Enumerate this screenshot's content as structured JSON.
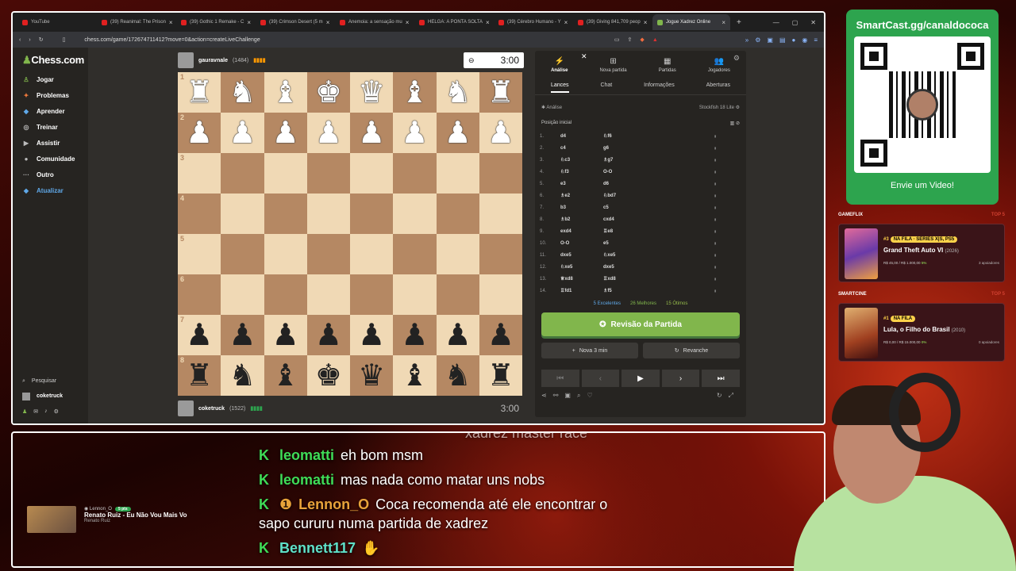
{
  "browser": {
    "tabs": [
      {
        "title": "YouTube"
      },
      {
        "title": "(39) Reanimal: The Prison"
      },
      {
        "title": "(39) Gothic 1 Remake - C"
      },
      {
        "title": "(39) Crimson Desert (5 m"
      },
      {
        "title": "Anemoia: a sensação mu"
      },
      {
        "title": "HELGA: A PONTA SOLTA"
      },
      {
        "title": "(39) Cérebro Humano - Y"
      },
      {
        "title": "(39) Giving 841,709 peop"
      },
      {
        "title": "Jogue Xadrez Online"
      }
    ],
    "url": "chess.com/game/172674711412?move=0&action=createLiveChallenge"
  },
  "chess": {
    "logo": "Chess.com",
    "nav": [
      {
        "icon": "♙",
        "label": "Jogar",
        "color": "#81b64c"
      },
      {
        "icon": "✦",
        "label": "Problemas",
        "color": "#f07a3c"
      },
      {
        "icon": "🎓",
        "label": "Aprender",
        "color": "#5fa8e8"
      },
      {
        "icon": "◎",
        "label": "Treinar",
        "color": "#bbb"
      },
      {
        "icon": "▶",
        "label": "Assistir",
        "color": "#bbb"
      },
      {
        "icon": "●",
        "label": "Comunidade",
        "color": "#bbb"
      },
      {
        "icon": "···",
        "label": "Outro",
        "color": "#bbb"
      },
      {
        "icon": "◆",
        "label": "Atualizar",
        "color": "#5fa8e8"
      }
    ],
    "search": "Pesquisar",
    "user": "coketruck",
    "top_player": {
      "name": "gauravnale",
      "rating": "(1484)"
    },
    "bottom_player": {
      "name": "coketruck",
      "rating": "(1522)"
    },
    "top_clock": "3:00",
    "bottom_clock": "3:00",
    "ranks": [
      "1",
      "2",
      "3",
      "4",
      "5",
      "6",
      "7",
      "8"
    ],
    "panel": {
      "tabs": [
        "Análise",
        "Nova partida",
        "Partidas",
        "Jogadores"
      ],
      "subtabs": [
        "Lances",
        "Chat",
        "Informações",
        "Aberturas"
      ],
      "analysis_label": "Análise",
      "engine": "Stockfish 18 Lite",
      "position": "Posição inicial",
      "moves": [
        {
          "n": "1.",
          "w": "d4",
          "b": "♘f6"
        },
        {
          "n": "2.",
          "w": "c4",
          "b": "g6"
        },
        {
          "n": "3.",
          "w": "♘c3",
          "b": "♗g7"
        },
        {
          "n": "4.",
          "w": "♘f3",
          "b": "O-O"
        },
        {
          "n": "5.",
          "w": "e3",
          "b": "d6"
        },
        {
          "n": "6.",
          "w": "♗e2",
          "b": "♘bd7"
        },
        {
          "n": "7.",
          "w": "b3",
          "b": "c5"
        },
        {
          "n": "8.",
          "w": "♗b2",
          "b": "cxd4"
        },
        {
          "n": "9.",
          "w": "exd4",
          "b": "♖e8"
        },
        {
          "n": "10.",
          "w": "O-O",
          "b": "e5"
        },
        {
          "n": "11.",
          "w": "dxe5",
          "b": "♘xe5"
        },
        {
          "n": "12.",
          "w": "♘xe5",
          "b": "dxe5"
        },
        {
          "n": "13.",
          "w": "♕xd8",
          "b": "♖xd8"
        },
        {
          "n": "14.",
          "w": "♖fd1",
          "b": "♗f5"
        }
      ],
      "stats": [
        "5 Excelentes",
        "26 Melhores",
        "15 Ótimos"
      ],
      "review": "Revisão da Partida",
      "new_game": "Nova 3 min",
      "rematch": "Revanche"
    }
  },
  "smartcast": {
    "title": "SmartCast.gg/canaldococa",
    "cta": "Envie um Video!"
  },
  "cards": [
    {
      "section": "GAMEFLIX",
      "tag": "TOP 5",
      "rank": "#3",
      "badge": "NA FILA · SERIES X|S, PS5",
      "title": "Grand Theft Auto VI",
      "year": "(2026)",
      "price": "R$ 45,00 / R$ 1.000,00",
      "pct": "5%",
      "supporters": "3 apoiadores"
    },
    {
      "section": "SMARTCINE",
      "tag": "TOP 5",
      "rank": "#1",
      "badge": "NA FILA",
      "title": "Lula, o Filho do Brasil",
      "year": "(2010)",
      "price": "R$ 0,00 / R$ 15.000,00",
      "pct": "0%",
      "supporters": "0 apoiadores"
    }
  ],
  "chat": {
    "lines": [
      {
        "user": "leomatti",
        "text": "eh bom msm",
        "color": "#3fdc57"
      },
      {
        "user": "leomatti",
        "text": "mas nada como matar uns nobs",
        "color": "#3fdc57"
      },
      {
        "user": "Lennon_O",
        "text": "Coca recomenda até ele encontrar o",
        "color": "#e8a33a"
      },
      {
        "user": "",
        "text": "sapo cururu numa partida de xadrez",
        "color": ""
      },
      {
        "user": "Bennett117",
        "text": "",
        "color": "#5fe0c8"
      }
    ],
    "cut_text": "xadrez master race",
    "music": {
      "user": "Lennon_O",
      "pts": "5 pts",
      "song": "Renato Ruiz - Eu Não Vou Mais Vo",
      "artist": "Renato Ruiz"
    }
  }
}
